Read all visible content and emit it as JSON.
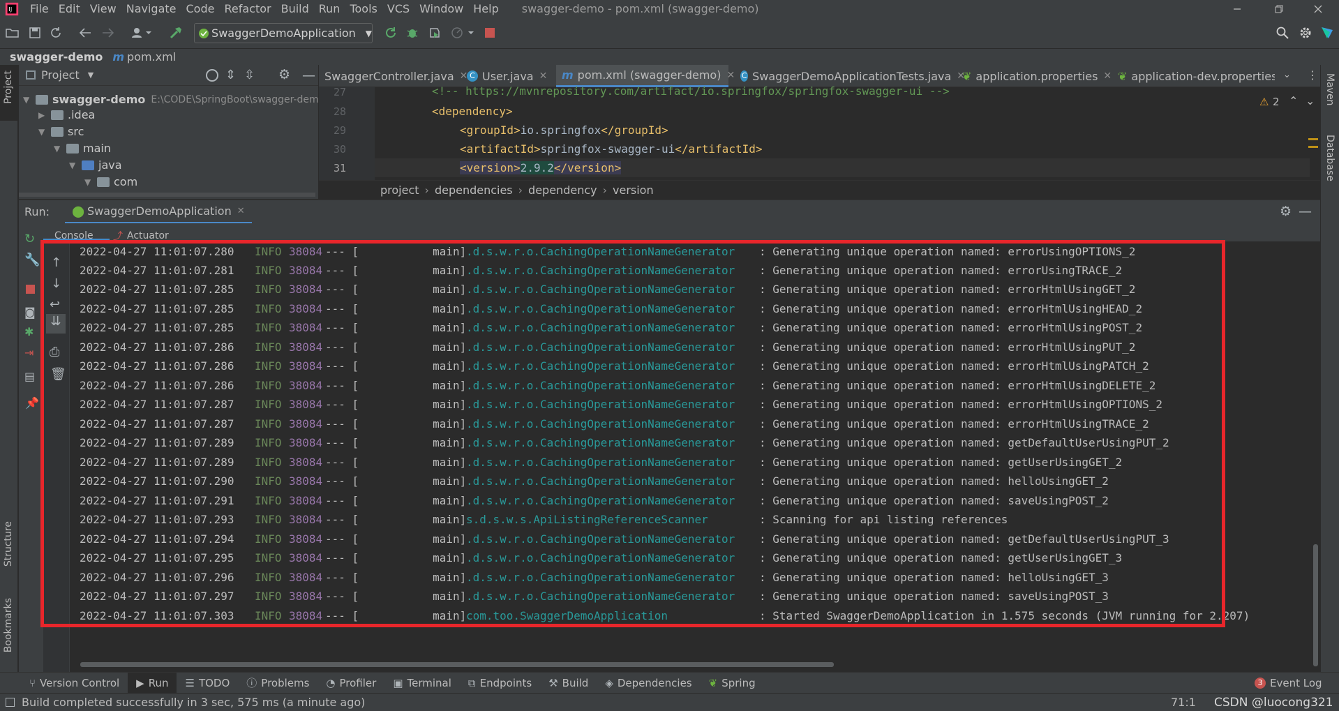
{
  "menu": {
    "items": [
      "File",
      "Edit",
      "View",
      "Navigate",
      "Code",
      "Refactor",
      "Build",
      "Run",
      "Tools",
      "VCS",
      "Window",
      "Help"
    ],
    "window_title": "swagger-demo - pom.xml (swagger-demo)"
  },
  "toolbar": {
    "run_config": "SwaggerDemoApplication"
  },
  "navbar": {
    "project": "swagger-demo",
    "file": "pom.xml"
  },
  "project_panel": {
    "title": "Project",
    "tree": [
      {
        "label": "swagger-demo",
        "path": "E:\\CODE\\SpringBoot\\swagger-dem"
      },
      {
        "label": ".idea"
      },
      {
        "label": "src"
      },
      {
        "label": "main"
      },
      {
        "label": "java"
      },
      {
        "label": "com"
      }
    ]
  },
  "tabs": [
    {
      "label": "SwaggerController.java"
    },
    {
      "label": "User.java"
    },
    {
      "label": "pom.xml (swagger-demo)"
    },
    {
      "label": "SwaggerDemoApplicationTests.java"
    },
    {
      "label": "application.properties"
    },
    {
      "label": "application-dev.properties"
    }
  ],
  "editor": {
    "warnings": "2",
    "lines": [
      {
        "num": "27",
        "text": "<!-- https://mvnrepository.com/artifact/io.springfox/springfox-swagger-ui -->"
      },
      {
        "num": "28",
        "text": "<dependency>"
      },
      {
        "num": "29",
        "open": "<groupId>",
        "value": "io.springfox",
        "close": "</groupId>"
      },
      {
        "num": "30",
        "open": "<artifactId>",
        "value": "springfox-swagger-ui",
        "close": "</artifactId>"
      },
      {
        "num": "31",
        "open": "<version>",
        "value": "2.9.2",
        "close": "</version>"
      }
    ],
    "breadcrumb": [
      "project",
      "dependencies",
      "dependency",
      "version"
    ]
  },
  "run_panel": {
    "label": "Run:",
    "tab": "SwaggerDemoApplication",
    "subtabs": [
      "Console",
      "Actuator"
    ]
  },
  "console": {
    "rows": [
      {
        "ts": "2022-04-27 11:01:07.280",
        "level": "INFO",
        "pid": "38084",
        "sep": "--- [           main]",
        "logger": ".d.s.w.r.o.CachingOperationNameGenerator",
        "msg": ": Generating unique operation named: errorUsingOPTIONS_2"
      },
      {
        "ts": "2022-04-27 11:01:07.281",
        "level": "INFO",
        "pid": "38084",
        "sep": "--- [           main]",
        "logger": ".d.s.w.r.o.CachingOperationNameGenerator",
        "msg": ": Generating unique operation named: errorUsingTRACE_2"
      },
      {
        "ts": "2022-04-27 11:01:07.285",
        "level": "INFO",
        "pid": "38084",
        "sep": "--- [           main]",
        "logger": ".d.s.w.r.o.CachingOperationNameGenerator",
        "msg": ": Generating unique operation named: errorHtmlUsingGET_2"
      },
      {
        "ts": "2022-04-27 11:01:07.285",
        "level": "INFO",
        "pid": "38084",
        "sep": "--- [           main]",
        "logger": ".d.s.w.r.o.CachingOperationNameGenerator",
        "msg": ": Generating unique operation named: errorHtmlUsingHEAD_2"
      },
      {
        "ts": "2022-04-27 11:01:07.285",
        "level": "INFO",
        "pid": "38084",
        "sep": "--- [           main]",
        "logger": ".d.s.w.r.o.CachingOperationNameGenerator",
        "msg": ": Generating unique operation named: errorHtmlUsingPOST_2"
      },
      {
        "ts": "2022-04-27 11:01:07.286",
        "level": "INFO",
        "pid": "38084",
        "sep": "--- [           main]",
        "logger": ".d.s.w.r.o.CachingOperationNameGenerator",
        "msg": ": Generating unique operation named: errorHtmlUsingPUT_2"
      },
      {
        "ts": "2022-04-27 11:01:07.286",
        "level": "INFO",
        "pid": "38084",
        "sep": "--- [           main]",
        "logger": ".d.s.w.r.o.CachingOperationNameGenerator",
        "msg": ": Generating unique operation named: errorHtmlUsingPATCH_2"
      },
      {
        "ts": "2022-04-27 11:01:07.286",
        "level": "INFO",
        "pid": "38084",
        "sep": "--- [           main]",
        "logger": ".d.s.w.r.o.CachingOperationNameGenerator",
        "msg": ": Generating unique operation named: errorHtmlUsingDELETE_2"
      },
      {
        "ts": "2022-04-27 11:01:07.287",
        "level": "INFO",
        "pid": "38084",
        "sep": "--- [           main]",
        "logger": ".d.s.w.r.o.CachingOperationNameGenerator",
        "msg": ": Generating unique operation named: errorHtmlUsingOPTIONS_2"
      },
      {
        "ts": "2022-04-27 11:01:07.287",
        "level": "INFO",
        "pid": "38084",
        "sep": "--- [           main]",
        "logger": ".d.s.w.r.o.CachingOperationNameGenerator",
        "msg": ": Generating unique operation named: errorHtmlUsingTRACE_2"
      },
      {
        "ts": "2022-04-27 11:01:07.289",
        "level": "INFO",
        "pid": "38084",
        "sep": "--- [           main]",
        "logger": ".d.s.w.r.o.CachingOperationNameGenerator",
        "msg": ": Generating unique operation named: getDefaultUserUsingPUT_2"
      },
      {
        "ts": "2022-04-27 11:01:07.289",
        "level": "INFO",
        "pid": "38084",
        "sep": "--- [           main]",
        "logger": ".d.s.w.r.o.CachingOperationNameGenerator",
        "msg": ": Generating unique operation named: getUserUsingGET_2"
      },
      {
        "ts": "2022-04-27 11:01:07.290",
        "level": "INFO",
        "pid": "38084",
        "sep": "--- [           main]",
        "logger": ".d.s.w.r.o.CachingOperationNameGenerator",
        "msg": ": Generating unique operation named: helloUsingGET_2"
      },
      {
        "ts": "2022-04-27 11:01:07.291",
        "level": "INFO",
        "pid": "38084",
        "sep": "--- [           main]",
        "logger": ".d.s.w.r.o.CachingOperationNameGenerator",
        "msg": ": Generating unique operation named: saveUsingPOST_2"
      },
      {
        "ts": "2022-04-27 11:01:07.293",
        "level": "INFO",
        "pid": "38084",
        "sep": "--- [           main]",
        "logger": "s.d.s.w.s.ApiListingReferenceScanner",
        "msg": ": Scanning for api listing references"
      },
      {
        "ts": "2022-04-27 11:01:07.294",
        "level": "INFO",
        "pid": "38084",
        "sep": "--- [           main]",
        "logger": ".d.s.w.r.o.CachingOperationNameGenerator",
        "msg": ": Generating unique operation named: getDefaultUserUsingPUT_3"
      },
      {
        "ts": "2022-04-27 11:01:07.295",
        "level": "INFO",
        "pid": "38084",
        "sep": "--- [           main]",
        "logger": ".d.s.w.r.o.CachingOperationNameGenerator",
        "msg": ": Generating unique operation named: getUserUsingGET_3"
      },
      {
        "ts": "2022-04-27 11:01:07.296",
        "level": "INFO",
        "pid": "38084",
        "sep": "--- [           main]",
        "logger": ".d.s.w.r.o.CachingOperationNameGenerator",
        "msg": ": Generating unique operation named: helloUsingGET_3"
      },
      {
        "ts": "2022-04-27 11:01:07.297",
        "level": "INFO",
        "pid": "38084",
        "sep": "--- [           main]",
        "logger": ".d.s.w.r.o.CachingOperationNameGenerator",
        "msg": ": Generating unique operation named: saveUsingPOST_3"
      },
      {
        "ts": "2022-04-27 11:01:07.303",
        "level": "INFO",
        "pid": "38084",
        "sep": "--- [           main]",
        "logger": "com.too.SwaggerDemoApplication",
        "msg": ": Started SwaggerDemoApplication in 1.575 seconds (JVM running for 2.207)"
      }
    ]
  },
  "bottom_tools": [
    {
      "label": "Version Control",
      "icon": "branch-icon"
    },
    {
      "label": "Run",
      "icon": "play-icon"
    },
    {
      "label": "TODO",
      "icon": "list-icon"
    },
    {
      "label": "Problems",
      "icon": "info-icon"
    },
    {
      "label": "Profiler",
      "icon": "profiler-icon"
    },
    {
      "label": "Terminal",
      "icon": "terminal-icon"
    },
    {
      "label": "Endpoints",
      "icon": "endpoints-icon"
    },
    {
      "label": "Build",
      "icon": "hammer-icon"
    },
    {
      "label": "Dependencies",
      "icon": "layers-icon"
    },
    {
      "label": "Spring",
      "icon": "leaf-icon"
    }
  ],
  "event_log": {
    "label": "Event Log",
    "count": "3"
  },
  "side_tools": {
    "left_top": "Project",
    "left_mid": "Structure",
    "left_bottom": "Bookmarks",
    "right_top": "Maven",
    "right_mid": "Database"
  },
  "status": {
    "message": "Build completed successfully in 3 sec, 575 ms (a minute ago)",
    "position": "71:1",
    "watermark": "CSDN @luocong321"
  },
  "colors": {
    "accent": "#4a88c7",
    "highlight_box": "#e8262b",
    "info_level": "#6a8759",
    "logger": "#299999",
    "pid": "#9876aa"
  }
}
